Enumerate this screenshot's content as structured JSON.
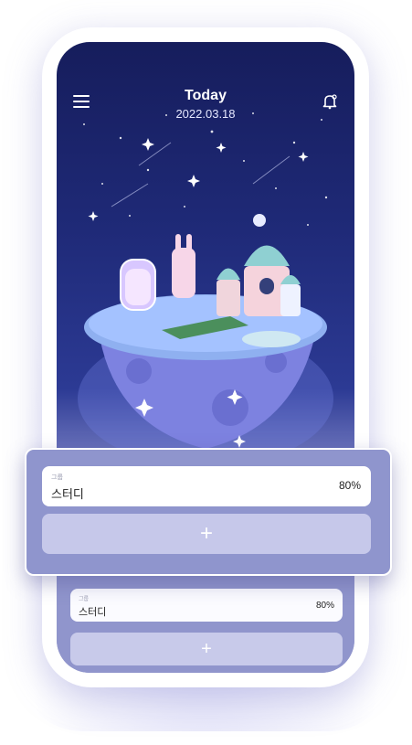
{
  "header": {
    "title": "Today",
    "date": "2022.03.18"
  },
  "icons": {
    "menu": "menu-icon",
    "bell": "bell-icon",
    "add": "plus-icon"
  },
  "groups_front": {
    "item": {
      "label": "그룹",
      "name": "스터디",
      "percent": "80%"
    },
    "add_symbol": "+"
  },
  "groups_back": {
    "item": {
      "label": "그룹",
      "name": "스터디",
      "percent": "80%"
    },
    "add_symbol": "+"
  },
  "colors": {
    "sky_top": "#161d5c",
    "card": "#8f95cd",
    "add_row": "#c6c8ea"
  }
}
